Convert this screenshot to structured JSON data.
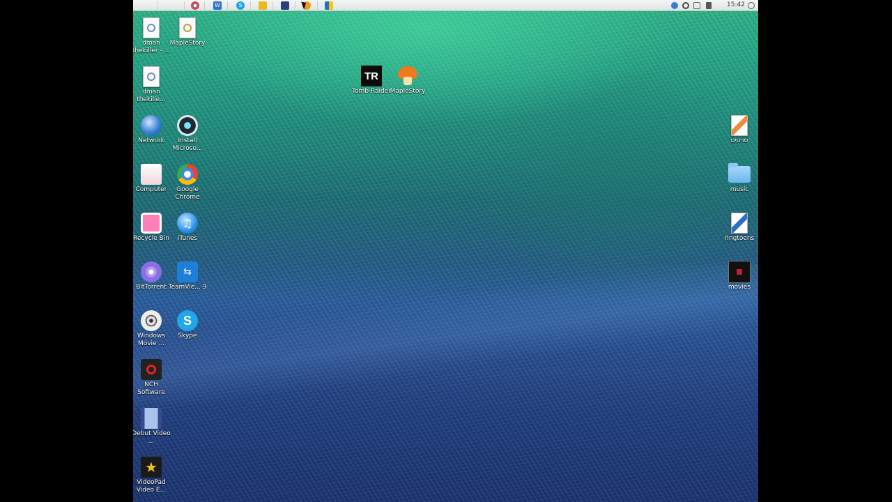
{
  "menubar": {
    "apps": [
      "apple-icon",
      "finder-cursor",
      "chrome-icon",
      "word-icon",
      "skype-icon",
      "folder-icon",
      "save-icon",
      "media-player-icon",
      "windows-logo-icon"
    ],
    "clock": "15:42"
  },
  "desktop": {
    "left_icons": [
      {
        "label": "dman thekiller - ...",
        "icon": "document-icon"
      },
      {
        "label": "MapleStory",
        "icon": "document-icon"
      },
      {
        "label": "dman thekille...",
        "icon": "document-icon"
      },
      {
        "label": "Network",
        "icon": "network-globe-icon"
      },
      {
        "label": "Install Microso...",
        "icon": "install-icon"
      },
      {
        "label": "Computer",
        "icon": "computer-icon"
      },
      {
        "label": "Google Chrome",
        "icon": "chrome-icon"
      },
      {
        "label": "Recycle Bin",
        "icon": "recycle-bin-icon"
      },
      {
        "label": "iTunes",
        "icon": "itunes-icon"
      },
      {
        "label": "BitTorrent",
        "icon": "bittorrent-icon"
      },
      {
        "label": "TeamVie... 9",
        "icon": "teamviewer-icon"
      },
      {
        "label": "Windows Movie ...",
        "icon": "movie-reel-icon"
      },
      {
        "label": "Skype",
        "icon": "skype-icon"
      },
      {
        "label": "NCH Software",
        "icon": "nch-icon"
      },
      {
        "label": "Debut Video ...",
        "icon": "film-icon"
      },
      {
        "label": "VideoPad Video E...",
        "icon": "star-clapper-icon"
      }
    ],
    "center_icons": [
      {
        "label": "Tomb Raider",
        "icon": "tomb-raider-icon",
        "badge": "TR"
      },
      {
        "label": "MapleStory",
        "icon": "mushroom-icon"
      }
    ],
    "right_icons": [
      {
        "label": "סרטים",
        "icon": "folder-doc-icon"
      },
      {
        "label": "music",
        "icon": "folder-icon"
      },
      {
        "label": "ringtoens",
        "icon": "folder-doc-icon"
      },
      {
        "label": "movies",
        "icon": "video-icon"
      }
    ]
  },
  "colors": {
    "wave_top": "#2fb98c",
    "wave_bottom": "#1a3472",
    "label_text": "#ffffff"
  }
}
